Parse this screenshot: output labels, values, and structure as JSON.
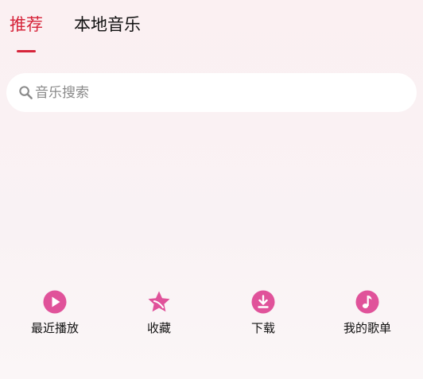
{
  "colors": {
    "accent_red": "#d6243a",
    "icon_pink": "#e0529a",
    "text_dark": "#111111",
    "placeholder": "#8a8a8a"
  },
  "tabs": [
    {
      "label": "推荐",
      "active": true
    },
    {
      "label": "本地音乐",
      "active": false
    }
  ],
  "search": {
    "icon": "search-icon",
    "placeholder": "音乐搜索"
  },
  "quick_actions": [
    {
      "label": "最近播放",
      "icon": "play-circle-icon"
    },
    {
      "label": "收藏",
      "icon": "star-icon"
    },
    {
      "label": "下载",
      "icon": "download-icon"
    },
    {
      "label": "我的歌单",
      "icon": "music-note-icon"
    }
  ]
}
